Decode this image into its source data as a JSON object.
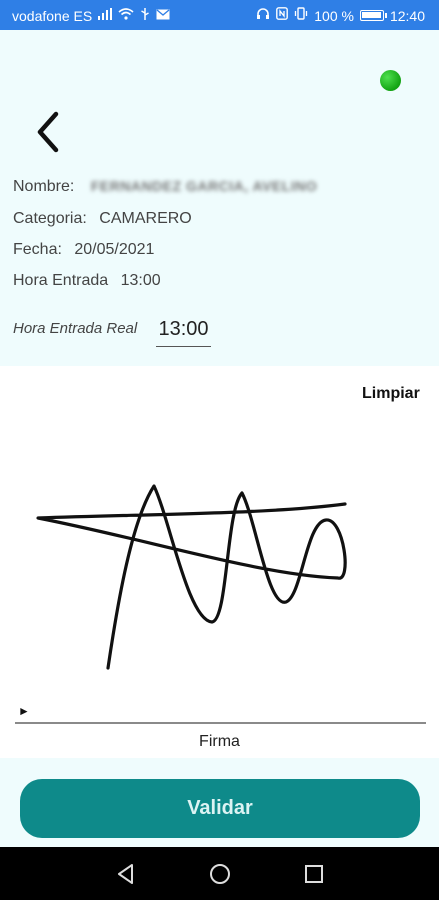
{
  "status_bar": {
    "carrier": "vodafone ES",
    "battery_percent": "100 %",
    "battery_level": 1.0,
    "time": "12:40",
    "icons": [
      "signal-icon",
      "wifi-icon",
      "usb-icon",
      "mail-icon",
      "headset-icon",
      "nfc-icon",
      "vibrate-icon",
      "battery-icon"
    ]
  },
  "connection_status": {
    "color": "#19b019",
    "icon": "green-status-dot"
  },
  "info": {
    "nombre_label": "Nombre:",
    "nombre_value": "FERNANDEZ GARCIA, AVELINO",
    "categoria_label": "Categoria:",
    "categoria_value": "CAMARERO",
    "fecha_label": "Fecha:",
    "fecha_value": "20/05/2021",
    "hora_entrada_label": "Hora Entrada",
    "hora_entrada_value": "13:00",
    "hora_real_label": "Hora Entrada Real",
    "hora_real_value": "13:00"
  },
  "signature": {
    "clear_label": "Limpiar",
    "marker": "►",
    "label": "Firma"
  },
  "actions": {
    "validate_label": "Validar"
  },
  "colors": {
    "status_bar": "#2f7fe6",
    "panel_bg": "#effcfd",
    "validate_bg": "#0e8a8a",
    "validate_text": "#dcf3f3"
  }
}
